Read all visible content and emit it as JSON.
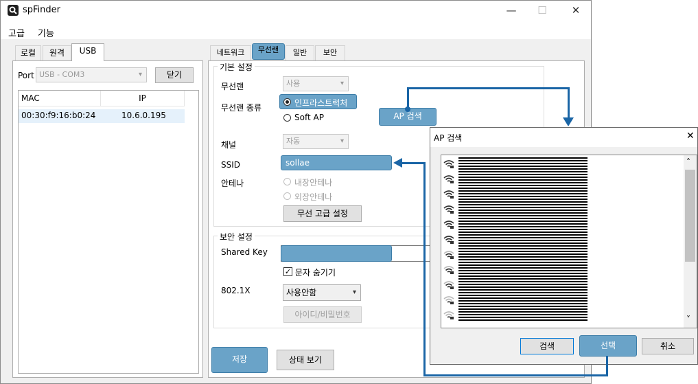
{
  "window": {
    "title": "spFinder",
    "minimize": "—",
    "maximize": "☐",
    "close": "✕"
  },
  "menu": {
    "items": [
      "고급",
      "기능"
    ]
  },
  "left_tabs": [
    "로컬",
    "원격",
    "USB"
  ],
  "port": {
    "label": "Port",
    "value": "USB - COM3",
    "close_button": "닫기"
  },
  "device_list": {
    "columns": [
      "MAC",
      "IP"
    ],
    "rows": [
      {
        "mac": "00:30:f9:16:b0:24",
        "ip": "10.6.0.195"
      }
    ]
  },
  "right_tabs": [
    "네트워크",
    "무선랜",
    "일반",
    "보안"
  ],
  "basic_settings": {
    "group_title": "기본 설정",
    "wlan_label": "무선랜",
    "wlan_value": "사용",
    "wlan_type_label": "무선랜 종류",
    "infra_label": "인프라스트럭처",
    "softap_label": "Soft AP",
    "ap_search_button": "AP 검색",
    "channel_label": "채널",
    "channel_value": "자동",
    "ssid_label": "SSID",
    "ssid_value": "sollae",
    "antenna_label": "안테나",
    "internal_antenna": "내장안테나",
    "external_antenna": "외장안테나",
    "advanced_button": "무선 고급 설정"
  },
  "security_settings": {
    "group_title": "보안 설정",
    "shared_key_label": "Shared Key",
    "hide_chars_label": "문자 숨기기",
    "checkmark": "✓",
    "dot1x_label": "802.1X",
    "dot1x_value": "사용안함",
    "id_pw_button": "아이디/비밀번호"
  },
  "bottom_buttons": {
    "save": "저장",
    "status": "상태 보기"
  },
  "ap_dialog": {
    "title": "AP 검색",
    "close": "✕",
    "search_button": "검색",
    "select_button": "선택",
    "cancel_button": "취소",
    "scroll_up": "˄",
    "scroll_down": "˅"
  },
  "colors": {
    "highlight": "#6aa3c8",
    "arrow": "#1a65a6"
  },
  "icons": {
    "app": "magnifier-icon",
    "wifi": "wifi-lock-icon",
    "combo_arrow": "chevron-down-icon"
  }
}
